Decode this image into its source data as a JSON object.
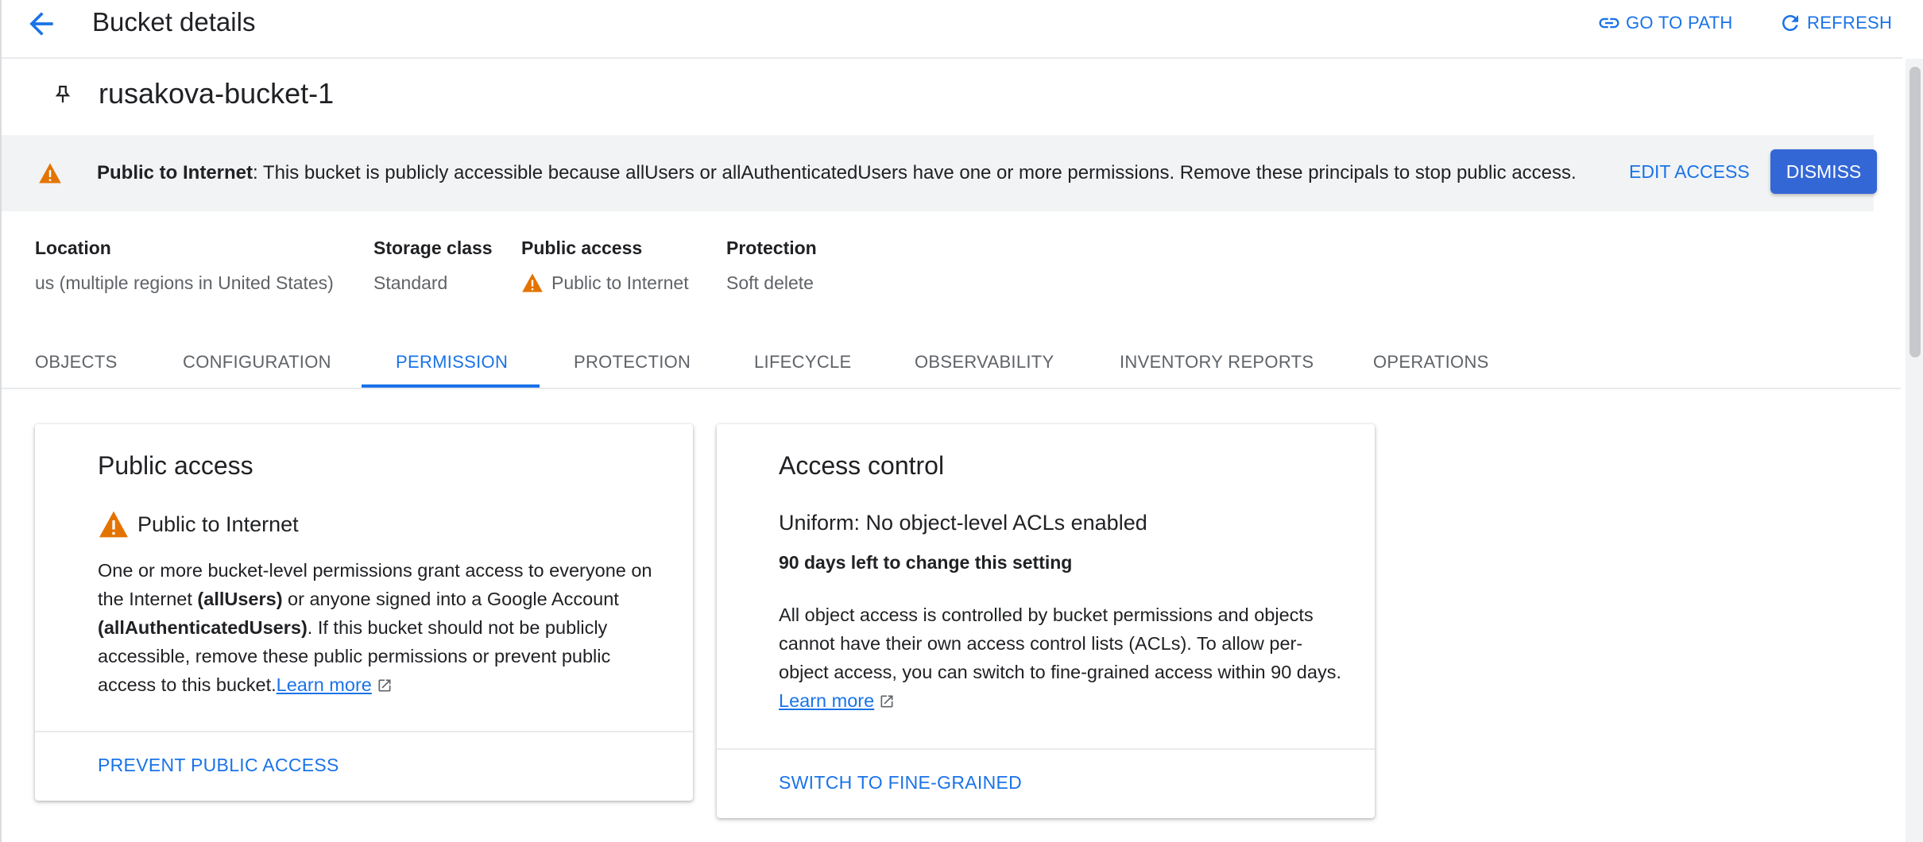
{
  "header": {
    "title": "Bucket details",
    "go_to_path": "GO TO PATH",
    "refresh": "REFRESH"
  },
  "bucket": {
    "name": "rusakova-bucket-1"
  },
  "banner": {
    "bold": "Public to Internet",
    "message": ": This bucket is publicly accessible because allUsers or allAuthenticatedUsers have one or more permissions. Remove these principals to stop public access.",
    "edit_access": "EDIT ACCESS",
    "dismiss": "DISMISS"
  },
  "meta": {
    "location_label": "Location",
    "location_value": "us (multiple regions in United States)",
    "storage_label": "Storage class",
    "storage_value": "Standard",
    "public_label": "Public access",
    "public_value": "Public to Internet",
    "protection_label": "Protection",
    "protection_value": "Soft delete"
  },
  "tabs": [
    {
      "label": "OBJECTS"
    },
    {
      "label": "CONFIGURATION"
    },
    {
      "label": "PERMISSION",
      "active": true
    },
    {
      "label": "PROTECTION"
    },
    {
      "label": "LIFECYCLE"
    },
    {
      "label": "OBSERVABILITY"
    },
    {
      "label": "INVENTORY REPORTS"
    },
    {
      "label": "OPERATIONS"
    }
  ],
  "public_access_card": {
    "title": "Public access",
    "status": "Public to Internet",
    "text_1": "One or more bucket-level permissions grant access to everyone on the Internet ",
    "bold_1": "(allUsers)",
    "text_2": " or anyone signed into a Google Account ",
    "bold_2": "(allAuthenticatedUsers)",
    "text_3": ". If this bucket should not be publicly accessible, remove these public permissions or prevent public access to this bucket.",
    "learn_more": "Learn more",
    "action": "PREVENT PUBLIC ACCESS"
  },
  "access_control_card": {
    "title": "Access control",
    "subtitle": "Uniform: No object-level ACLs enabled",
    "days_left": "90 days left to change this setting",
    "description": "All object access is controlled by bucket permissions and objects cannot have their own access control lists (ACLs). To allow per-object access, you can switch to fine-grained access within 90 days.",
    "learn_more": "Learn more",
    "action": "SWITCH TO FINE-GRAINED"
  },
  "colors": {
    "accent": "#1a73e8",
    "warning": "#e37400",
    "banner_bg": "#f1f3f4",
    "primary_button": "#3367d6"
  }
}
